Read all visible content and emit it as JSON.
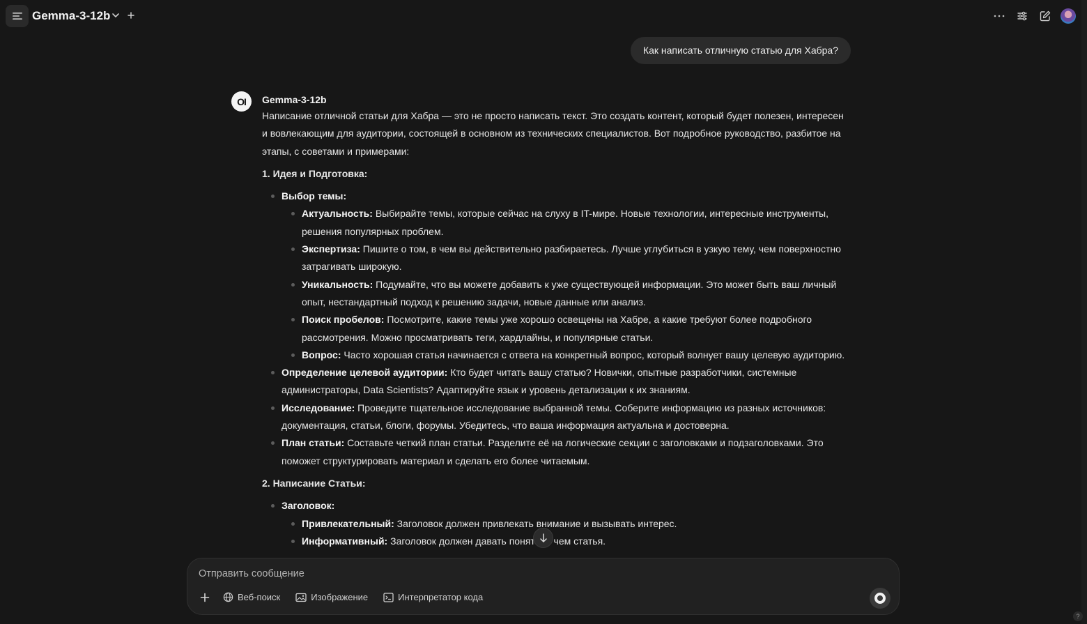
{
  "header": {
    "model_name": "Gemma-3-12b"
  },
  "user_message": "Как написать отличную статью для Хабра?",
  "assistant": {
    "avatar_text": "OI",
    "name": "Gemma-3-12b",
    "intro": "Написание отличной статьи для Хабра — это не просто написать текст. Это создать контент, который будет полезен, интересен и вовлекающим для аудитории, состоящей в основном из технических специалистов. Вот подробное руководство, разбитое на этапы, с советами и примерами:",
    "sections": [
      {
        "title": "1. Идея и Подготовка:",
        "items": [
          {
            "label": "Выбор темы:",
            "text": "",
            "sub": [
              {
                "label": "Актуальность:",
                "text": " Выбирайте темы, которые сейчас на слуху в IT-мире. Новые технологии, интересные инструменты, решения популярных проблем."
              },
              {
                "label": "Экспертиза:",
                "text": " Пишите о том, в чем вы действительно разбираетесь. Лучше углубиться в узкую тему, чем поверхностно затрагивать широкую."
              },
              {
                "label": "Уникальность:",
                "text": " Подумайте, что вы можете добавить к уже существующей информации. Это может быть ваш личный опыт, нестандартный подход к решению задачи, новые данные или анализ."
              },
              {
                "label": "Поиск пробелов:",
                "text": " Посмотрите, какие темы уже хорошо освещены на Хабре, а какие требуют более подробного рассмотрения. Можно просматривать теги, хардлайны, и популярные статьи."
              },
              {
                "label": "Вопрос:",
                "text": " Часто хорошая статья начинается с ответа на конкретный вопрос, который волнует вашу целевую аудиторию."
              }
            ]
          },
          {
            "label": "Определение целевой аудитории:",
            "text": " Кто будет читать вашу статью? Новички, опытные разработчики, системные администраторы, Data Scientists? Адаптируйте язык и уровень детализации к их знаниям."
          },
          {
            "label": "Исследование:",
            "text": " Проведите тщательное исследование выбранной темы. Соберите информацию из разных источников: документация, статьи, блоги, форумы. Убедитесь, что ваша информация актуальна и достоверна."
          },
          {
            "label": "План статьи:",
            "text": " Составьте четкий план статьи. Разделите её на логические секции с заголовками и подзаголовками. Это поможет структурировать материал и сделать его более читаемым."
          }
        ]
      },
      {
        "title": "2. Написание Статьи:",
        "items": [
          {
            "label": "Заголовок:",
            "text": "",
            "sub": [
              {
                "label": "Привлекательный:",
                "text": " Заголовок должен привлекать внимание и вызывать интерес."
              },
              {
                "label": "Информативный:",
                "text": " Заголовок должен давать понять, о чем статья."
              }
            ]
          }
        ]
      }
    ]
  },
  "composer": {
    "placeholder": "Отправить сообщение",
    "tools": {
      "web_search": "Веб-поиск",
      "image": "Изображение",
      "code_interpreter": "Интерпретатор кода"
    }
  },
  "help_label": "?"
}
